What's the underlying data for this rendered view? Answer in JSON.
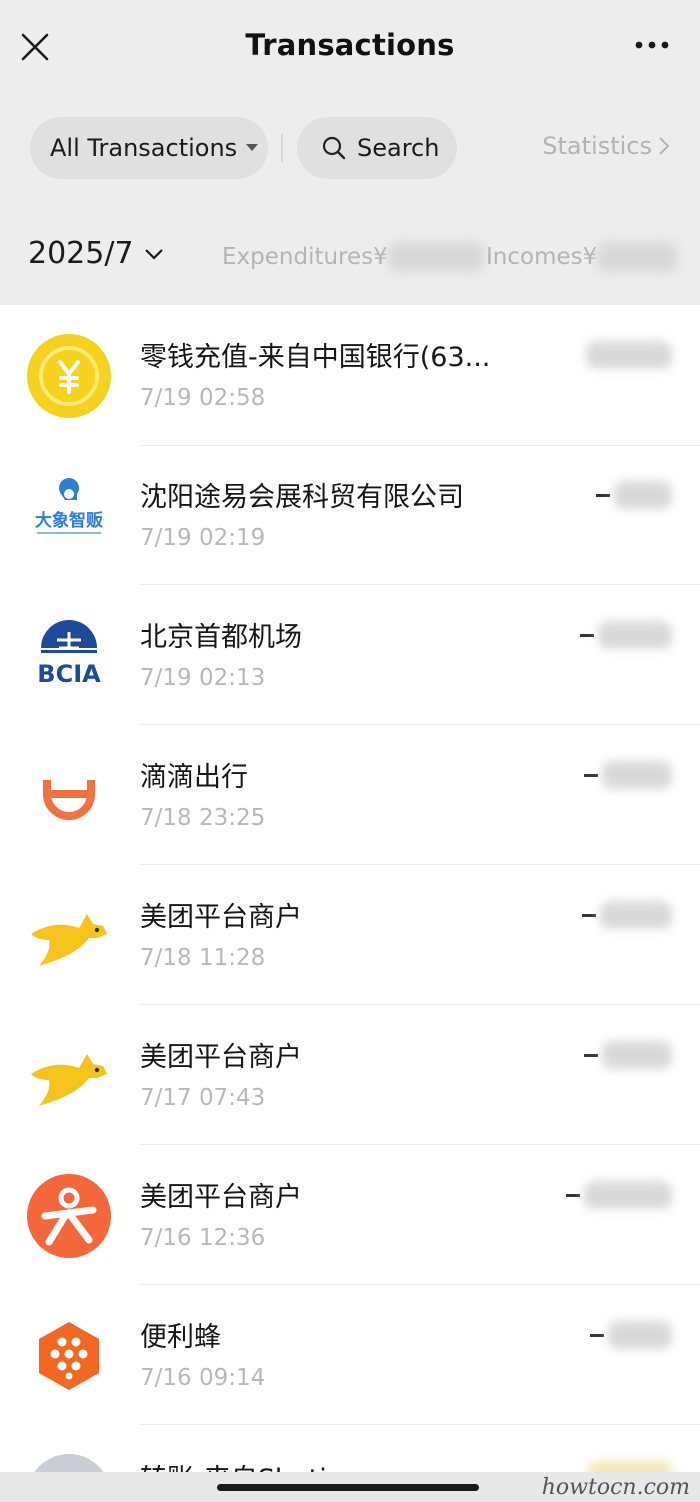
{
  "nav": {
    "title": "Transactions"
  },
  "filters": {
    "all_label": "All Transactions",
    "search_label": "Search",
    "stats_label": "Statistics"
  },
  "summary": {
    "month": "2025/7",
    "expenditures_label": "Expenditures¥",
    "incomes_label": "Incomes¥"
  },
  "transactions": [
    {
      "name": "零钱充值-来自中国银行(63...",
      "time": "7/19 02:58",
      "icon": "coin-icon",
      "amount_sign": ""
    },
    {
      "name": "沈阳途易会展科贸有限公司",
      "time": "7/19 02:19",
      "icon": "elephant-vending-icon",
      "logo_text": "大象智贩",
      "amount_sign": "-"
    },
    {
      "name": "北京首都机场",
      "time": "7/19 02:13",
      "icon": "bcia-icon",
      "logo_text": "BCIA",
      "amount_sign": "-"
    },
    {
      "name": "滴滴出行",
      "time": "7/18 23:25",
      "icon": "didi-icon",
      "amount_sign": "-"
    },
    {
      "name": "美团平台商户",
      "time": "7/18 11:28",
      "icon": "meituan-kangaroo-icon",
      "amount_sign": "-"
    },
    {
      "name": "美团平台商户",
      "time": "7/17 07:43",
      "icon": "meituan-kangaroo-icon",
      "amount_sign": "-"
    },
    {
      "name": "美团平台商户",
      "time": "7/16 12:36",
      "icon": "dianping-icon",
      "amount_sign": "-"
    },
    {
      "name": "便利蜂",
      "time": "7/16 09:14",
      "icon": "bianlifeng-icon",
      "amount_sign": "-"
    }
  ],
  "partial_row": {
    "name": "转账-来自Shetie"
  },
  "watermark": "howtocn.com",
  "colors": {
    "header_bg": "#ededed",
    "chip_bg": "#e0e0e0",
    "muted": "#b3b3b3"
  }
}
